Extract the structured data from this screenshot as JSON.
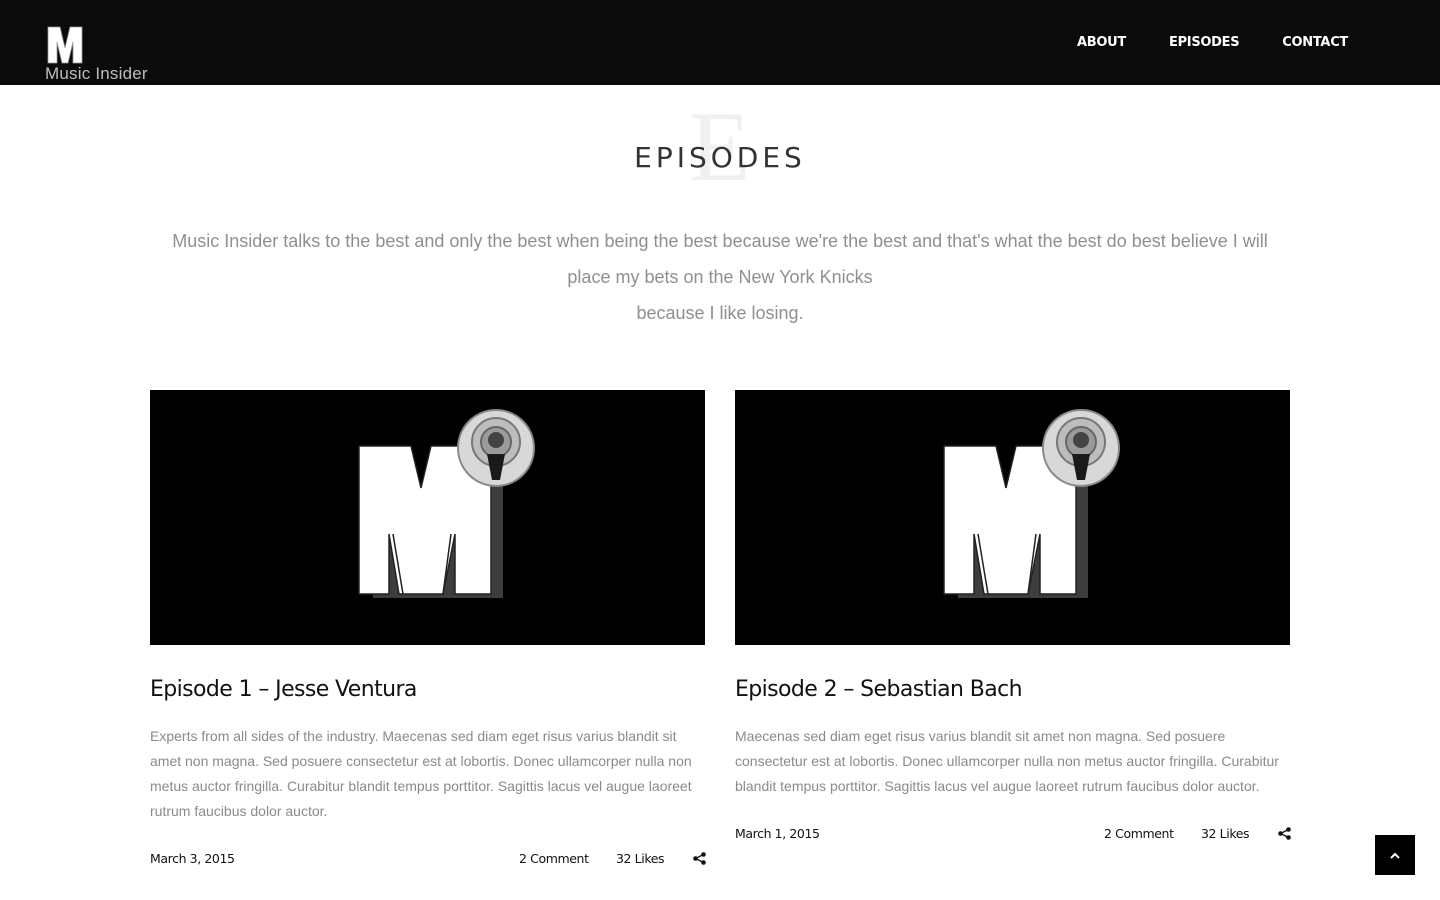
{
  "brand": {
    "name": "Music Insider",
    "logo_letter": "M",
    "logo_icon": "m-logo-icon"
  },
  "nav": {
    "items": [
      "ABOUT",
      "EPISODES",
      "CONTACT"
    ]
  },
  "section": {
    "ghost_letter": "E",
    "title": "EPISODES",
    "intro_line1": "Music Insider talks to the best and only the best when being the best because we're the best and that's what the best do best believe I will place my bets on the New York Knicks",
    "intro_line2": "because I like losing."
  },
  "episodes": [
    {
      "title": "Episode 1 – Jesse Ventura",
      "excerpt": "Experts from all sides of the industry. Maecenas sed diam eget risus varius blandit sit amet non magna. Sed posuere consectetur est at lobortis. Donec ullamcorper nulla non metus auctor fringilla. Curabitur blandit tempus porttitor. Sagittis lacus vel augue laoreet rutrum faucibus dolor auctor.",
      "date": "March 3, 2015",
      "comments": "2 Comment",
      "likes": "32 Likes",
      "thumbnail_icon": "podcast-logo-icon"
    },
    {
      "title": "Episode 2 – Sebastian Bach",
      "excerpt": "Maecenas sed diam eget risus varius blandit sit amet non magna. Sed posuere consectetur est at lobortis. Donec ullamcorper nulla non metus auctor fringilla. Curabitur blandit tempus porttitor. Sagittis lacus vel augue laoreet rutrum faucibus dolor auctor.",
      "date": "March 1, 2015",
      "comments": "2 Comment",
      "likes": "32 Likes",
      "thumbnail_icon": "podcast-logo-icon"
    }
  ],
  "icons": {
    "share": "share-icon",
    "back_to_top": "chevron-up-icon"
  },
  "colors": {
    "header_bg": "#0b0b0b",
    "text_muted": "#8a8a8a",
    "accent": "#000000"
  }
}
